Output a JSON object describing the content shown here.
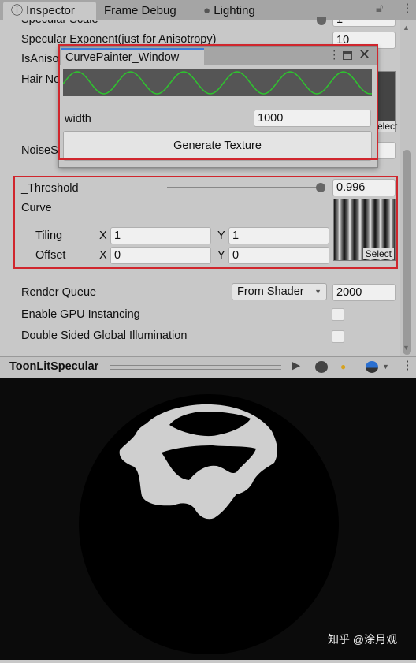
{
  "tabs": [
    {
      "label": "Inspector",
      "icon": "info-icon"
    },
    {
      "label": "Frame Debug"
    },
    {
      "label": "Lighting",
      "icon": "bulb-icon"
    }
  ],
  "properties": {
    "specular_scale": {
      "label": "Specular Scale",
      "value": "1"
    },
    "specular_exponent": {
      "label": "Specular Exponent(just for Anisotropy)",
      "value": "10"
    },
    "is_aniso": {
      "label": "IsAniso"
    },
    "hair_noise": {
      "label": "Hair No",
      "select": "Select"
    },
    "noise_s": {
      "label": "NoiseS"
    }
  },
  "popup": {
    "title": "CurvePainter_Window",
    "width_label": "width",
    "width_value": "1000",
    "generate_label": "Generate Texture",
    "curve_color": "#2ec52e"
  },
  "threshold": {
    "label": "_Threshold",
    "value": "0.996",
    "slider_fraction": 0.996
  },
  "curve": {
    "label": "Curve",
    "tiling_label": "Tiling",
    "offset_label": "Offset",
    "x": "X",
    "y": "Y",
    "tiling_x": "1",
    "tiling_y": "1",
    "offset_x": "0",
    "offset_y": "0",
    "select": "Select"
  },
  "render_queue": {
    "label": "Render Queue",
    "dropdown": "From Shader",
    "value": "2000"
  },
  "gpu_instancing": {
    "label": "Enable GPU Instancing",
    "checked": false
  },
  "double_sided": {
    "label": "Double Sided Global Illumination",
    "checked": false
  },
  "preview": {
    "title": "ToonLitSpecular"
  },
  "watermark": "知乎 @涂月观",
  "colors": {
    "highlight": "#d0262d",
    "panel": "#c8c8c8"
  }
}
